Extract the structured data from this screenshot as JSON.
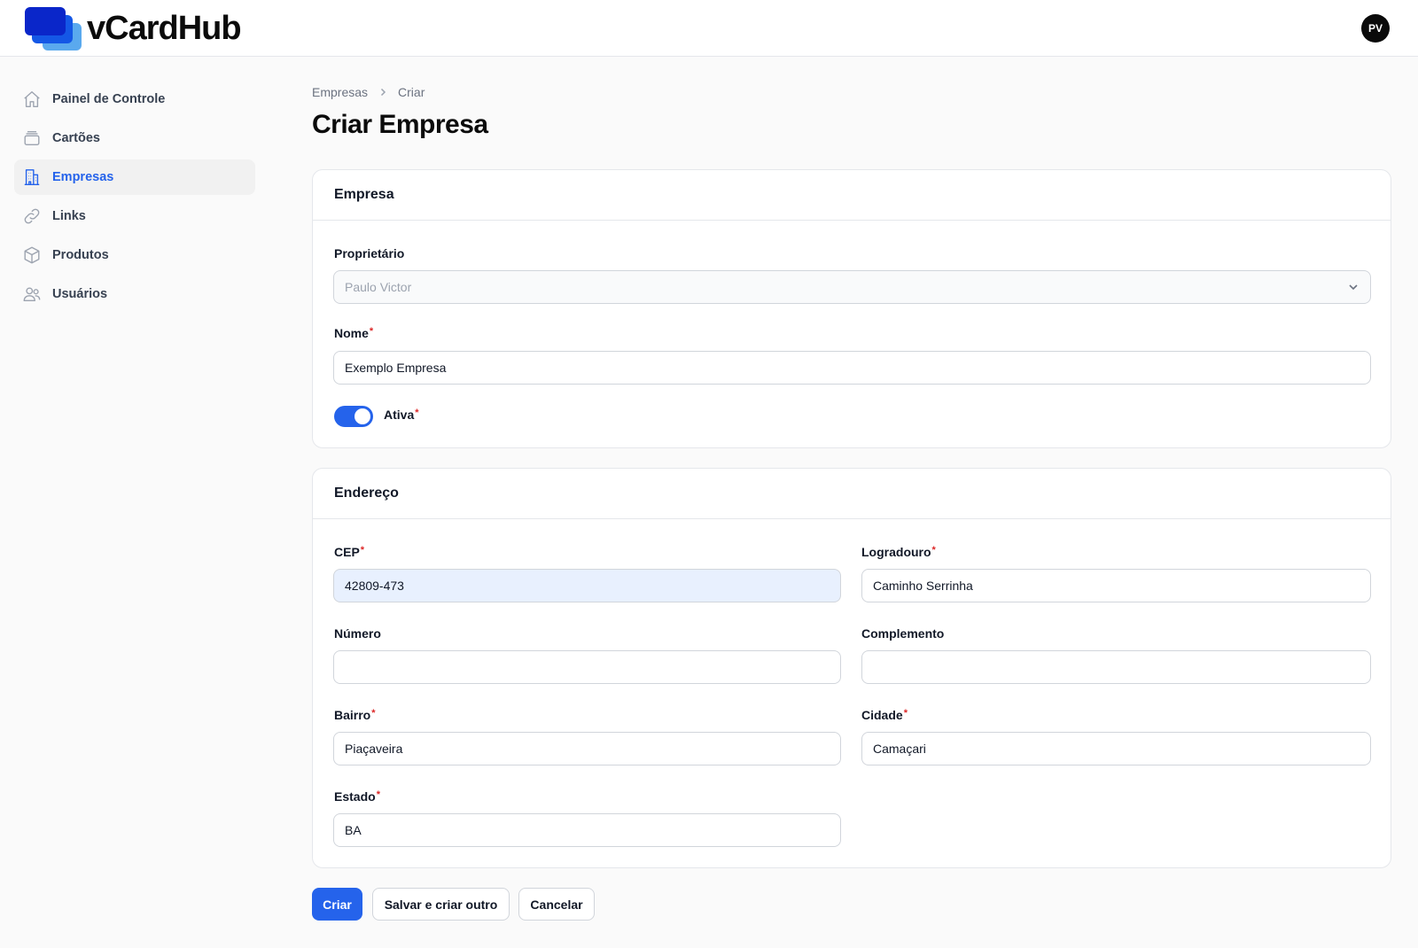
{
  "app": {
    "name": "vCardHub"
  },
  "user": {
    "initials": "PV"
  },
  "sidebar": {
    "items": [
      {
        "label": "Painel de Controle",
        "icon": "home-icon",
        "active": false
      },
      {
        "label": "Cartões",
        "icon": "cards-icon",
        "active": false
      },
      {
        "label": "Empresas",
        "icon": "building-icon",
        "active": true
      },
      {
        "label": "Links",
        "icon": "link-icon",
        "active": false
      },
      {
        "label": "Produtos",
        "icon": "cube-icon",
        "active": false
      },
      {
        "label": "Usuários",
        "icon": "users-icon",
        "active": false
      }
    ]
  },
  "breadcrumb": {
    "parent": "Empresas",
    "current": "Criar"
  },
  "page": {
    "title": "Criar Empresa"
  },
  "empresa": {
    "title": "Empresa",
    "owner": {
      "label": "Proprietário",
      "value": "Paulo Victor"
    },
    "name": {
      "label": "Nome",
      "value": "Exemplo Empresa"
    },
    "active": {
      "label": "Ativa",
      "on": true
    }
  },
  "endereco": {
    "title": "Endereço",
    "cep": {
      "label": "CEP",
      "value": "42809-473"
    },
    "logradouro": {
      "label": "Logradouro",
      "value": "Caminho Serrinha"
    },
    "numero": {
      "label": "Número",
      "value": ""
    },
    "complemento": {
      "label": "Complemento",
      "value": ""
    },
    "bairro": {
      "label": "Bairro",
      "value": "Piaçaveira"
    },
    "cidade": {
      "label": "Cidade",
      "value": "Camaçari"
    },
    "estado": {
      "label": "Estado",
      "value": "BA"
    }
  },
  "actions": {
    "create": "Criar",
    "save_another": "Salvar e criar outro",
    "cancel": "Cancelar"
  },
  "colors": {
    "accent": "#2563eb",
    "required": "#dc2626",
    "logo_dark": "#0a26c9",
    "logo_mid": "#1457e6",
    "logo_light": "#5aa9ee"
  },
  "required_mark": "*"
}
